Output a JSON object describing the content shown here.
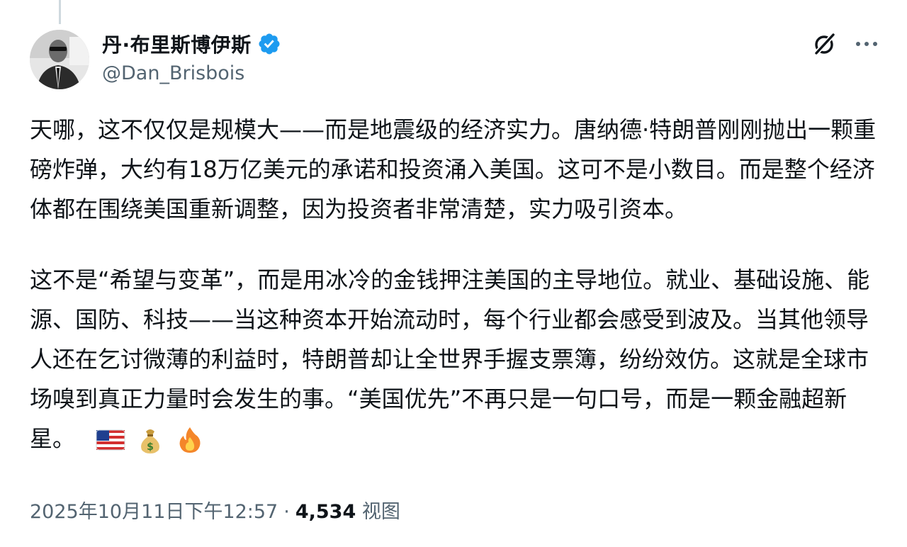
{
  "author": {
    "display_name": "丹·布里斯博伊斯",
    "handle": "@Dan_Brisbois",
    "verified": true,
    "verified_color": "#1d9bf0"
  },
  "header_icons": {
    "grok": "grok-icon",
    "more": "more-icon"
  },
  "tweet": {
    "paragraphs": [
      "天哪，这不仅仅是规模大——而是地震级的经济实力。唐纳德·特朗普刚刚抛出一颗重磅炸弹，大约有18万亿美元的承诺和投资涌入美国。这可不是小数目。而是整个经济体都在围绕美国重新调整，因为投资者非常清楚，实力吸引资本。",
      "这不是“希望与变革”，而是用冰冷的金钱押注美国的主导地位。就业、基础设施、能源、国防、科技——当这种资本开始流动时，每个行业都会感受到波及。当其他领导人还在乞讨微薄的利益时，特朗普却让全世界手握支票簿，纷纷效仿。这就是全球市场嗅到真正力量时会发生的事。“美国优先”不再只是一句口号，而是一颗金融超新星。"
    ],
    "emojis": [
      "us-flag",
      "money-bag",
      "fire"
    ]
  },
  "meta": {
    "timestamp": "2025年10月11日下午12:57",
    "separator": "·",
    "views_count": "4,534",
    "views_label": "视图"
  },
  "colors": {
    "text": "#0f1419",
    "secondary": "#536471",
    "verified": "#1d9bf0"
  }
}
